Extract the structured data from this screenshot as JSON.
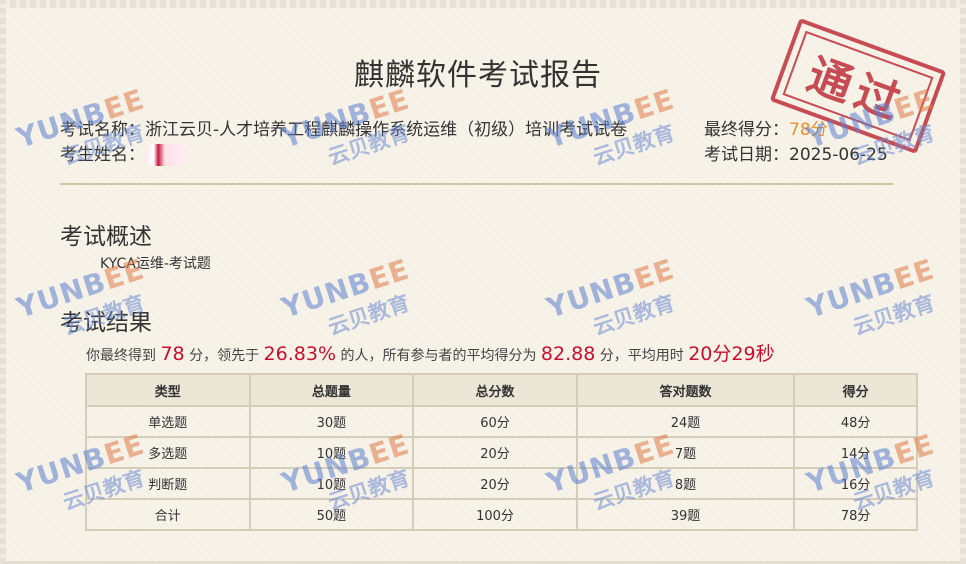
{
  "report": {
    "title": "麒麟软件考试报告",
    "exam_name_label": "考试名称：",
    "exam_name": "浙江云贝-人才培养工程麒麟操作系统运维（初级）培训考试试卷",
    "candidate_label": "考生姓名：",
    "final_score_label": "最终得分：",
    "final_score": "78分",
    "exam_date_label": "考试日期：",
    "exam_date": "2025-06-25",
    "stamp_text": "通过"
  },
  "overview": {
    "title": "考试概述",
    "text": "KYCA运维-考试题"
  },
  "results": {
    "title": "考试结果",
    "summary": {
      "p1": "你最终得到",
      "score": "78",
      "p2": "分，领先于",
      "percent": "26.83%",
      "p3": "的人，所有参与者的平均得分为",
      "avg": "82.88",
      "p4": "分，平均用时",
      "time": "20分29秒"
    },
    "table": {
      "headers": [
        "类型",
        "总题量",
        "总分数",
        "答对题数",
        "得分"
      ],
      "rows": [
        [
          "单选题",
          "30题",
          "60分",
          "24题",
          "48分"
        ],
        [
          "多选题",
          "10题",
          "20分",
          "7题",
          "14分"
        ],
        [
          "判断题",
          "10题",
          "20分",
          "8题",
          "16分"
        ],
        [
          "合计",
          "50题",
          "100分",
          "39题",
          "78分"
        ]
      ]
    }
  },
  "watermark": {
    "en_a": "YUNB",
    "en_b": "EE",
    "cn": "云贝教育"
  },
  "colors": {
    "accent_orange": "#e8912d",
    "highlight_red": "#c8102e",
    "stamp_red": "#c23b44",
    "watermark_blue": "#5b7fcf"
  }
}
